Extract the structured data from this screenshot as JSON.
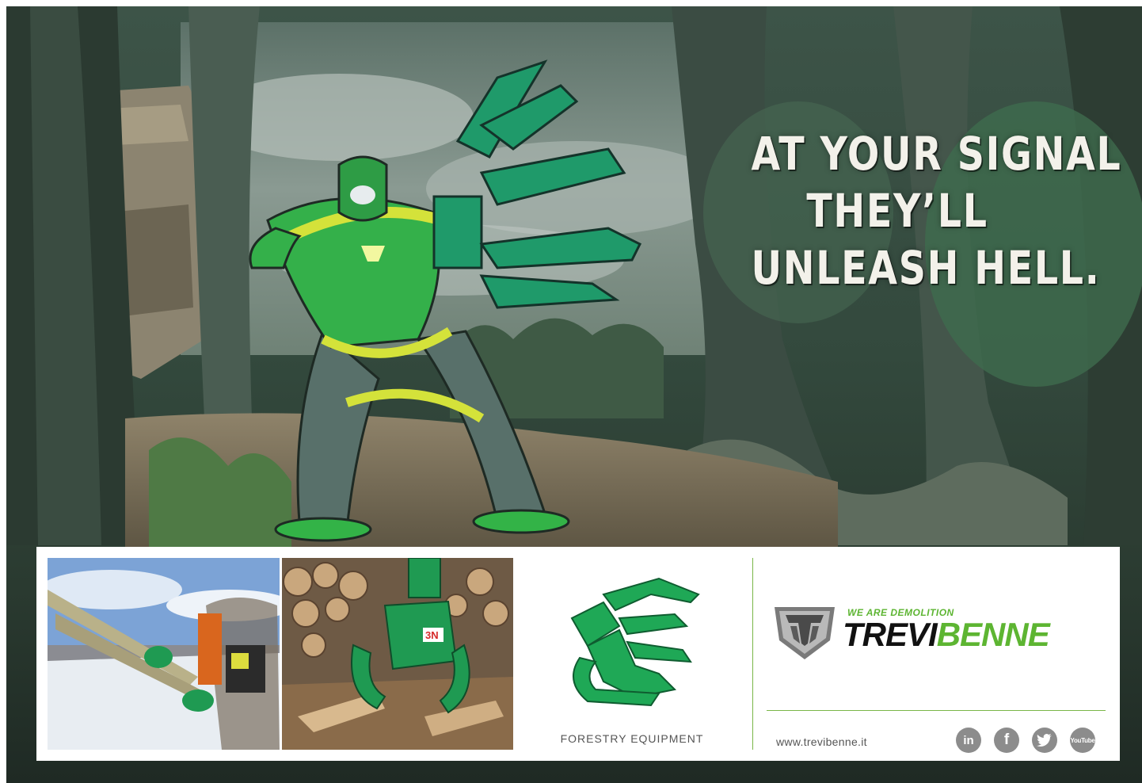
{
  "headline": {
    "line1": "AT YOUR SIGNAL",
    "line2": "THEY’LL",
    "line3": "UNLEASH HELL."
  },
  "photos": [
    {
      "icon": "excavator-snow-photo"
    },
    {
      "icon": "grapple-logs-photo",
      "badge": "3N"
    }
  ],
  "product": {
    "label": "FORESTRY EQUIPMENT",
    "icon": "forestry-grapple-icon"
  },
  "brand": {
    "tagline": "WE ARE DEMOLITION",
    "name_part1": "TREVI",
    "name_part2": "BENNE",
    "url": "www.trevibenne.it"
  },
  "social": {
    "linkedin": "in",
    "facebook": "f",
    "twitter": "t",
    "youtube": "YouTube"
  },
  "colors": {
    "brand_green": "#5db532",
    "machine_green": "#1f9a52",
    "divider_green": "#7ab648",
    "social_grey": "#8c8c8c"
  }
}
